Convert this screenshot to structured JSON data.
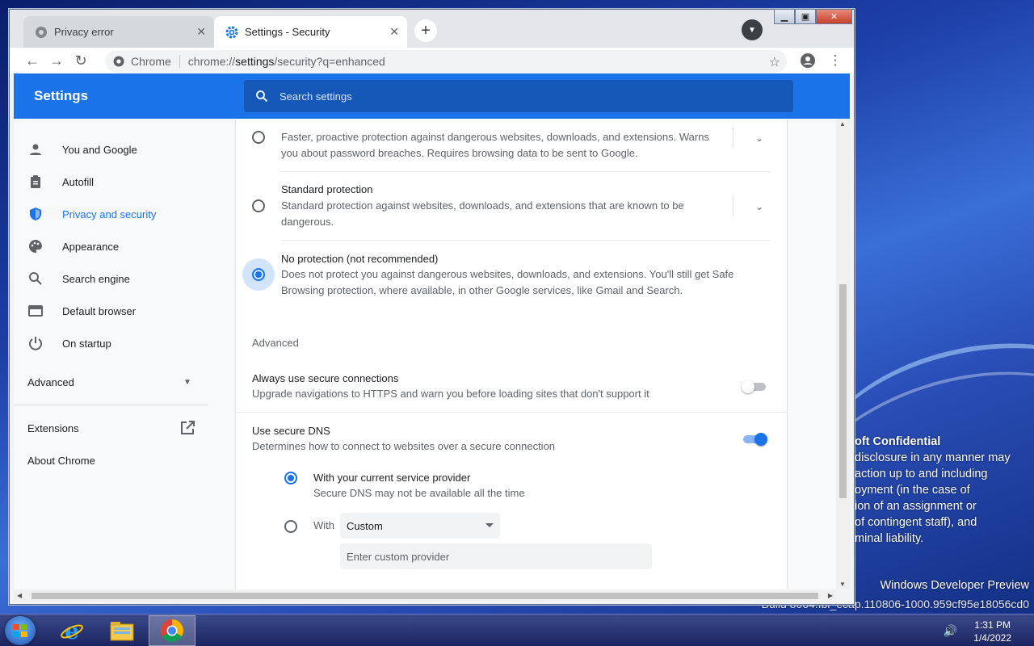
{
  "browser": {
    "tabs": [
      {
        "title": "Privacy error",
        "icon": "privacy-error-icon"
      },
      {
        "title": "Settings - Security",
        "icon": "settings-gear-icon"
      }
    ],
    "omnibox": {
      "site": "Chrome",
      "url_prefix": "chrome://",
      "url_host": "settings",
      "url_rest": "/security?q=enhanced"
    }
  },
  "settings": {
    "title": "Settings",
    "search_placeholder": "Search settings",
    "sidebar": {
      "items": [
        {
          "label": "You and Google",
          "icon": "person-icon"
        },
        {
          "label": "Autofill",
          "icon": "clipboard-icon"
        },
        {
          "label": "Privacy and security",
          "icon": "shield-icon"
        },
        {
          "label": "Appearance",
          "icon": "palette-icon"
        },
        {
          "label": "Search engine",
          "icon": "search-icon"
        },
        {
          "label": "Default browser",
          "icon": "browser-icon"
        },
        {
          "label": "On startup",
          "icon": "power-icon"
        }
      ],
      "advanced": "Advanced",
      "extensions": "Extensions",
      "about": "About Chrome"
    },
    "protection": {
      "enhanced_desc": "Faster, proactive protection against dangerous websites, downloads, and extensions. Warns you about password breaches. Requires browsing data to be sent to Google.",
      "standard_title": "Standard protection",
      "standard_desc": "Standard protection against websites, downloads, and extensions that are known to be dangerous.",
      "none_title": "No protection (not recommended)",
      "none_desc": "Does not protect you against dangerous websites, downloads, and extensions. You'll still get Safe Browsing protection, where available, in other Google services, like Gmail and Search."
    },
    "advanced": {
      "heading": "Advanced",
      "https_title": "Always use secure connections",
      "https_desc": "Upgrade navigations to HTTPS and warn you before loading sites that don't support it",
      "https_on": false,
      "dns_title": "Use secure DNS",
      "dns_desc": "Determines how to connect to websites over a secure connection",
      "dns_on": true,
      "dns_current_title": "With your current service provider",
      "dns_current_desc": "Secure DNS may not be available all the time",
      "dns_with": "With",
      "dns_select_value": "Custom",
      "dns_custom_placeholder": "Enter custom provider"
    }
  },
  "desktop": {
    "watermark": [
      "oft Confidential",
      "disclosure in any manner may",
      "action up to and including",
      "oyment (in the case of",
      "ion of an assignment or",
      "of contingent staff), and",
      "minal liability."
    ],
    "preview": "Windows Developer Preview",
    "build": "Build 8064.fbl_ecap.110806-1000.959cf95e18056cd0"
  },
  "taskbar": {
    "time": "1:31 PM",
    "date": "1/4/2022"
  },
  "colors": {
    "accent": "#1a73e8",
    "header": "#1a73e8"
  }
}
